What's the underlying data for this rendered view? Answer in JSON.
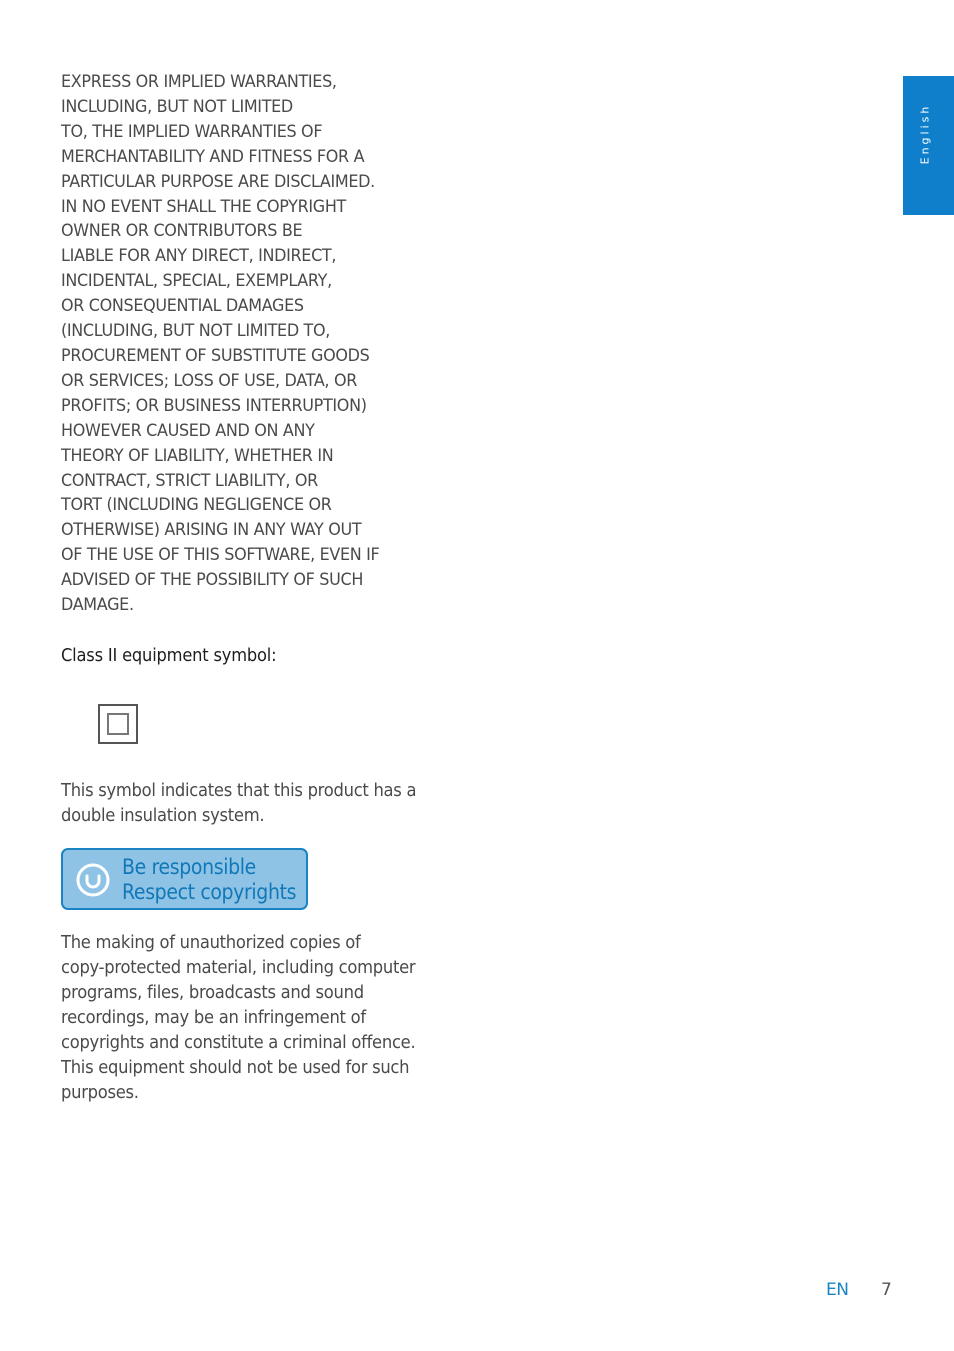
{
  "side_tab": {
    "label": "English",
    "color": "#0f7fcb"
  },
  "disclaimer": {
    "lines": [
      "EXPRESS OR IMPLIED WARRANTIES,",
      "INCLUDING, BUT NOT LIMITED",
      "TO, THE IMPLIED WARRANTIES OF",
      "MERCHANTABILITY AND FITNESS FOR A",
      "PARTICULAR PURPOSE ARE DISCLAIMED.",
      "IN NO EVENT SHALL THE COPYRIGHT",
      "OWNER OR CONTRIBUTORS BE",
      "LIABLE FOR ANY DIRECT, INDIRECT,",
      "INCIDENTAL, SPECIAL, EXEMPLARY,",
      "OR CONSEQUENTIAL DAMAGES",
      "(INCLUDING, BUT NOT LIMITED TO,",
      "PROCUREMENT OF SUBSTITUTE GOODS",
      "OR SERVICES; LOSS OF USE, DATA, OR",
      "PROFITS; OR BUSINESS INTERRUPTION)",
      "HOWEVER CAUSED AND ON ANY",
      "THEORY OF LIABILITY, WHETHER IN",
      "CONTRACT, STRICT LIABILITY, OR",
      "TORT (INCLUDING NEGLIGENCE OR",
      "OTHERWISE) ARISING IN ANY WAY OUT",
      "OF THE USE OF THIS SOFTWARE, EVEN IF",
      "ADVISED OF THE POSSIBILITY OF SUCH",
      "DAMAGE."
    ]
  },
  "class2": {
    "heading": "Class II equipment symbol:",
    "symbol_icon": "double-square-class-ii-icon",
    "description_lines": [
      "This symbol indicates that this product has a",
      "double insulation system."
    ]
  },
  "banner": {
    "icon": "circle-smile-icon",
    "line1": "Be responsible",
    "line2": "Respect copyrights",
    "background": "#8fc3e6",
    "border": "#1b84c4",
    "text_color": "#1178b8"
  },
  "copyright_paragraph": {
    "lines": [
      "The making of unauthorized copies of",
      "copy-protected material, including computer",
      "programs, files, broadcasts and sound",
      "recordings, may be an infringement of",
      "copyrights and constitute a criminal offence.",
      "This equipment should not be used for such",
      "purposes."
    ]
  },
  "footer": {
    "language_code": "EN",
    "page_number": "7"
  }
}
